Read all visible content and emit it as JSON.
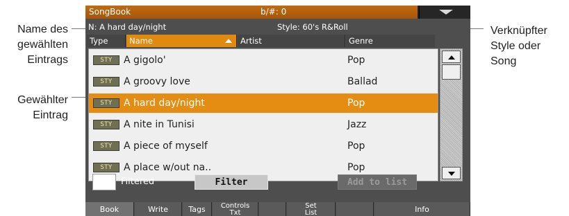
{
  "annotations": {
    "selected_name": [
      "Name des",
      "gewählten",
      "Eintrags"
    ],
    "selected_item": [
      "Gewählter",
      "Eintrag"
    ],
    "linked": [
      "Verknüpfter",
      "Style oder",
      "Song"
    ]
  },
  "titlebar": {
    "title": "SongBook",
    "accidentals": "b/#: 0"
  },
  "info": {
    "selected_name": "N: A hard day/night",
    "linked": "Style: 60's R&Roll"
  },
  "columns": {
    "type": "Type",
    "name": "Name",
    "artist": "Artist",
    "genre": "Genre"
  },
  "rows": [
    {
      "type": "STY",
      "name": "A gigolo'",
      "genre": "Pop",
      "selected": false
    },
    {
      "type": "STY",
      "name": "A groovy love",
      "genre": "Ballad",
      "selected": false
    },
    {
      "type": "STY",
      "name": "A hard day/night",
      "genre": "Pop",
      "selected": true
    },
    {
      "type": "STY",
      "name": "A nite in Tunisi",
      "genre": "Jazz",
      "selected": false
    },
    {
      "type": "STY",
      "name": "A piece of myself",
      "genre": "Pop",
      "selected": false
    },
    {
      "type": "STY",
      "name": "A place w/out na..",
      "genre": "Pop",
      "selected": false
    }
  ],
  "controls": {
    "filtered_label": "Filtered",
    "filter": "Filter",
    "add_to_list": "Add to list"
  },
  "tabs": [
    {
      "label": "Book",
      "active": true
    },
    {
      "label": "Write",
      "active": false
    },
    {
      "label": "Tags",
      "active": false
    },
    {
      "label": "Controls\nTxt",
      "active": false
    },
    {
      "label": "",
      "active": false
    },
    {
      "label": "Set\nList",
      "active": false
    },
    {
      "label": "",
      "active": false
    },
    {
      "label": "Info",
      "active": false
    }
  ],
  "colors": {
    "accent": "#e08a10",
    "screen_bg": "#4e4e4e",
    "list_bg": "#efefef"
  }
}
